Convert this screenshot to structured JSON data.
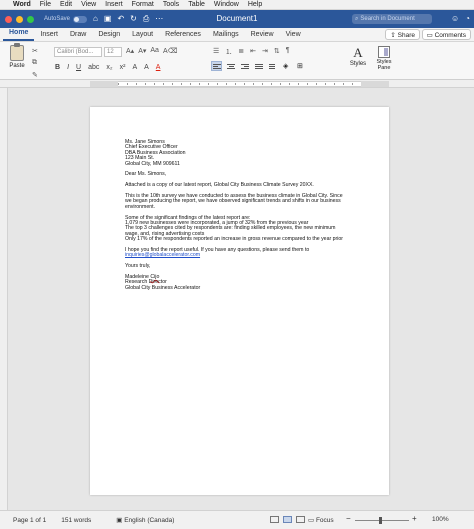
{
  "menubar": {
    "apple": "",
    "items": [
      "Word",
      "File",
      "Edit",
      "View",
      "Insert",
      "Format",
      "Tools",
      "Table",
      "Window",
      "Help"
    ]
  },
  "titlebar": {
    "autosave_label": "AutoSave",
    "autosave_state": "OFF",
    "doc_title": "Document1",
    "search_placeholder": "Search in Document"
  },
  "tabs": [
    "Home",
    "Insert",
    "Draw",
    "Design",
    "Layout",
    "References",
    "Mailings",
    "Review",
    "View"
  ],
  "active_tab": "Home",
  "share_label": "Share",
  "comments_label": "Comments",
  "ribbon": {
    "paste_label": "Paste",
    "font_name": "Calibri (Bod...",
    "font_size": "12",
    "format_buttons": [
      "B",
      "I",
      "U",
      "abc",
      "x₂",
      "x²",
      "A",
      "A",
      "A"
    ],
    "styles_label": "Styles",
    "styles_glyph": "A",
    "styles_pane_label": "Styles Pane"
  },
  "letter": {
    "recipient": [
      "Ms. Jane Simons",
      "Chief Executive Officer",
      "DBA Business Association",
      "123 Main St.",
      "Global City, MM 909611"
    ],
    "salutation": "Dear Ms. Simons,",
    "p1": "Attached is a copy of our latest report, Global City Business Climate Survey 20XX.",
    "p2": [
      "This is the 10th survey we have conducted to assess the business climate in Global City. Since",
      "we began producing the report, we have observed significant trends and shifts in our business",
      "environment."
    ],
    "p3": [
      "Some of the significant findings of the latest report are:",
      "1,079 new businesses were incorporated, a jump of 32% from the previous year",
      "The top 3 challenges cited by respondents are: finding skilled employees, the new minimum",
      "wage, and, rising advertising costs",
      "Only 17% of the respondents reported an increase in gross revenue compared to the year prior"
    ],
    "p4": "I hope you find the report useful. If you have any questions, please send them to",
    "email": "inquiries@globalaccelerator.com",
    "closing": "Yours truly,",
    "signer_first": "Madeleine ",
    "signer_last": "Cijo",
    "signer_title": "Research Director",
    "signer_org": "Global City Business Accelerator"
  },
  "status": {
    "page": "Page 1 of 1",
    "words": "151 words",
    "language": "English (Canada)",
    "focus": "Focus",
    "zoom": "100%"
  }
}
